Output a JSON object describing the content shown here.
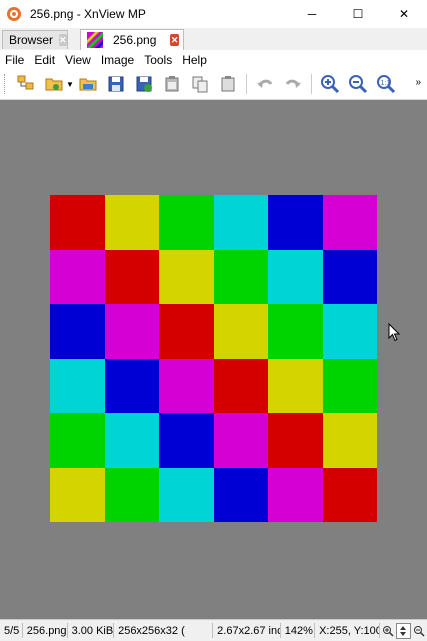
{
  "window": {
    "title": "256.png - XnView MP",
    "minimize_glyph": "─",
    "maximize_glyph": "☐",
    "close_glyph": "✕"
  },
  "tabs": [
    {
      "label": "Browser",
      "active": false
    },
    {
      "label": "256.png",
      "active": true
    }
  ],
  "menu": [
    {
      "label": "File"
    },
    {
      "label": "Edit"
    },
    {
      "label": "View"
    },
    {
      "label": "Image"
    },
    {
      "label": "Tools"
    },
    {
      "label": "Help"
    }
  ],
  "toolbar": {
    "buttons": [
      "browse-icon",
      "open-folder-icon",
      "folder-icon",
      "save-icon",
      "save-as-icon",
      "paste-icon",
      "copy-icon",
      "clipboard-icon",
      "undo-icon",
      "redo-icon",
      "zoom-in-icon",
      "zoom-out-icon",
      "zoom-actual-icon"
    ],
    "more_glyph": "»"
  },
  "image": {
    "checker_rows": [
      [
        "#d40000",
        "#d4d400",
        "#00d400",
        "#00d4d4",
        "#0000d4",
        "#d400d4"
      ],
      [
        "#d400d4",
        "#d40000",
        "#d4d400",
        "#00d400",
        "#00d4d4",
        "#0000d4"
      ],
      [
        "#0000d4",
        "#d400d4",
        "#d40000",
        "#d4d400",
        "#00d400",
        "#00d4d4"
      ],
      [
        "#00d4d4",
        "#0000d4",
        "#d400d4",
        "#d40000",
        "#d4d400",
        "#00d400"
      ],
      [
        "#00d400",
        "#00d4d4",
        "#0000d4",
        "#d400d4",
        "#d40000",
        "#d4d400"
      ],
      [
        "#d4d400",
        "#00d400",
        "#00d4d4",
        "#0000d4",
        "#d400d4",
        "#d40000"
      ]
    ]
  },
  "status": {
    "index": "5/5",
    "filename": "256.png",
    "filesize": "3.00 KiB",
    "dimensions": "256x256x32 (",
    "print_size": "2.67x2.67 inc",
    "zoom": "142%",
    "coords": "X:255, Y:100"
  },
  "colors": {
    "accent": "#d9452b",
    "viewer_bg": "#808080"
  }
}
